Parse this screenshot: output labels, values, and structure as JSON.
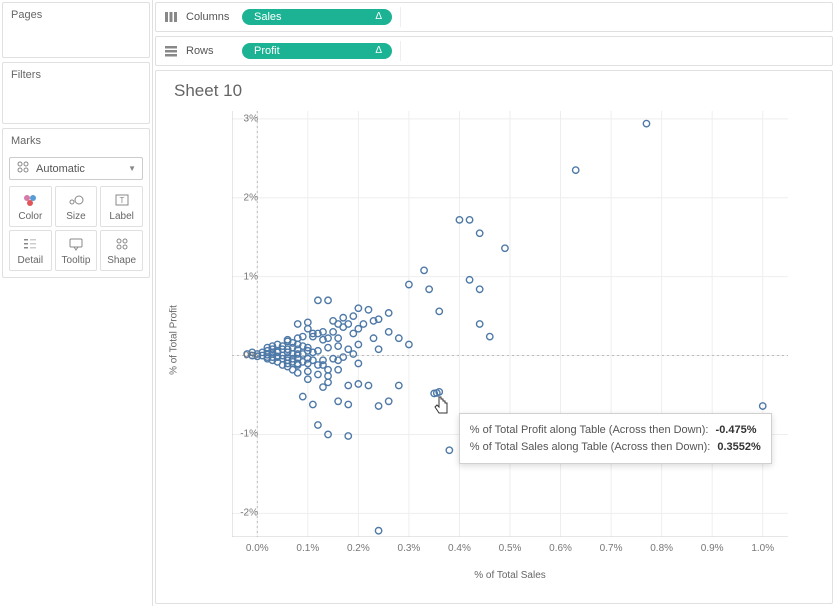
{
  "left": {
    "pages_title": "Pages",
    "filters_title": "Filters",
    "marks_title": "Marks",
    "marks_type": "Automatic",
    "cells": {
      "color": "Color",
      "size": "Size",
      "label": "Label",
      "detail": "Detail",
      "tooltip": "Tooltip",
      "shape": "Shape"
    }
  },
  "shelves": {
    "columns_label": "Columns",
    "rows_label": "Rows",
    "columns_pill": "Sales",
    "rows_pill": "Profit",
    "delta": "Δ"
  },
  "sheet": {
    "title": "Sheet 10",
    "xlabel": "% of Total Sales",
    "ylabel": "% of Total Profit"
  },
  "tooltip": {
    "line1_label": "% of Total Profit along Table (Across then Down):",
    "line1_value": "-0.475%",
    "line2_label": "% of Total Sales along Table (Across then Down):",
    "line2_value": "0.3552%"
  },
  "chart_data": {
    "type": "scatter",
    "xlabel": "% of Total Sales",
    "ylabel": "% of Total Profit",
    "xlim": [
      -0.05,
      1.05
    ],
    "ylim": [
      -2.3,
      3.1
    ],
    "xticks": [
      "0.0%",
      "0.1%",
      "0.2%",
      "0.3%",
      "0.4%",
      "0.5%",
      "0.6%",
      "0.7%",
      "0.8%",
      "0.9%",
      "1.0%"
    ],
    "yticks": [
      "-2%",
      "-1%",
      "0%",
      "1%",
      "2%",
      "3%"
    ],
    "zero_lines": true,
    "highlighted_point": {
      "x": 0.3552,
      "y": -0.475
    },
    "series": [
      {
        "name": "points",
        "points": [
          [
            0.77,
            2.94
          ],
          [
            0.63,
            2.35
          ],
          [
            0.4,
            1.72
          ],
          [
            0.42,
            1.72
          ],
          [
            0.44,
            1.55
          ],
          [
            0.49,
            1.36
          ],
          [
            0.33,
            1.08
          ],
          [
            0.42,
            0.96
          ],
          [
            0.3,
            0.9
          ],
          [
            0.34,
            0.84
          ],
          [
            0.44,
            0.84
          ],
          [
            0.12,
            0.7
          ],
          [
            0.14,
            0.7
          ],
          [
            0.2,
            0.6
          ],
          [
            0.22,
            0.58
          ],
          [
            0.26,
            0.54
          ],
          [
            0.24,
            0.46
          ],
          [
            0.36,
            0.56
          ],
          [
            0.16,
            0.4
          ],
          [
            0.18,
            0.4
          ],
          [
            0.44,
            0.4
          ],
          [
            0.1,
            0.34
          ],
          [
            0.11,
            0.28
          ],
          [
            0.12,
            0.28
          ],
          [
            0.13,
            0.3
          ],
          [
            0.14,
            0.22
          ],
          [
            0.16,
            0.22
          ],
          [
            0.2,
            0.34
          ],
          [
            0.19,
            0.28
          ],
          [
            0.23,
            0.22
          ],
          [
            0.06,
            0.18
          ],
          [
            0.07,
            0.16
          ],
          [
            0.08,
            0.14
          ],
          [
            0.09,
            0.12
          ],
          [
            0.1,
            0.1
          ],
          [
            0.05,
            0.08
          ],
          [
            0.04,
            0.06
          ],
          [
            0.06,
            0.04
          ],
          [
            0.08,
            0.02
          ],
          [
            0.46,
            0.24
          ],
          [
            0.03,
            0.02
          ],
          [
            0.03,
            0.04
          ],
          [
            0.04,
            0.04
          ],
          [
            0.02,
            0.01
          ],
          [
            0.01,
            0.0
          ],
          [
            0.0,
            -0.01
          ],
          [
            0.02,
            0.1
          ],
          [
            0.03,
            0.12
          ],
          [
            0.05,
            0.12
          ],
          [
            0.06,
            0.2
          ],
          [
            0.08,
            0.22
          ],
          [
            0.04,
            -0.02
          ],
          [
            0.05,
            -0.04
          ],
          [
            0.06,
            -0.06
          ],
          [
            0.07,
            -0.08
          ],
          [
            0.08,
            -0.1
          ],
          [
            0.1,
            -0.1
          ],
          [
            0.12,
            -0.12
          ],
          [
            0.14,
            -0.18
          ],
          [
            0.16,
            -0.18
          ],
          [
            0.1,
            -0.2
          ],
          [
            0.12,
            -0.24
          ],
          [
            0.14,
            -0.26
          ],
          [
            0.18,
            -0.38
          ],
          [
            0.2,
            -0.36
          ],
          [
            0.22,
            -0.38
          ],
          [
            0.13,
            -0.4
          ],
          [
            0.28,
            -0.38
          ],
          [
            0.09,
            -0.52
          ],
          [
            0.16,
            -0.58
          ],
          [
            0.24,
            -0.64
          ],
          [
            0.18,
            -0.62
          ],
          [
            0.26,
            -0.58
          ],
          [
            0.11,
            -0.62
          ],
          [
            0.36,
            -0.46
          ],
          [
            0.35,
            -0.48
          ],
          [
            0.12,
            -0.88
          ],
          [
            0.14,
            -1.0
          ],
          [
            0.18,
            -1.02
          ],
          [
            0.38,
            -1.2
          ],
          [
            0.24,
            -2.22
          ],
          [
            1.0,
            -0.64
          ],
          [
            0.11,
            0.24
          ],
          [
            0.13,
            0.2
          ],
          [
            0.15,
            0.3
          ],
          [
            0.17,
            0.36
          ],
          [
            0.09,
            0.24
          ],
          [
            0.07,
            0.1
          ],
          [
            0.06,
            0.08
          ],
          [
            0.08,
            0.08
          ],
          [
            0.1,
            0.06
          ],
          [
            0.12,
            0.06
          ],
          [
            0.14,
            0.1
          ],
          [
            0.16,
            0.12
          ],
          [
            0.18,
            0.08
          ],
          [
            0.2,
            0.14
          ],
          [
            0.11,
            0.04
          ],
          [
            0.09,
            0.02
          ],
          [
            0.07,
            0.02
          ],
          [
            0.05,
            0.0
          ],
          [
            0.04,
            -0.01
          ],
          [
            0.03,
            -0.02
          ],
          [
            0.02,
            -0.02
          ],
          [
            0.02,
            -0.04
          ],
          [
            0.06,
            -0.02
          ],
          [
            0.08,
            -0.04
          ],
          [
            0.1,
            -0.04
          ],
          [
            0.11,
            -0.06
          ],
          [
            0.13,
            -0.06
          ],
          [
            0.15,
            -0.04
          ],
          [
            0.17,
            -0.02
          ],
          [
            0.14,
            -0.34
          ],
          [
            0.1,
            -0.3
          ],
          [
            0.08,
            -0.22
          ],
          [
            0.07,
            -0.18
          ],
          [
            0.06,
            -0.14
          ],
          [
            -0.02,
            0.02
          ],
          [
            -0.01,
            0.04
          ],
          [
            -0.01,
            0.0
          ],
          [
            0.0,
            0.02
          ],
          [
            0.01,
            0.04
          ],
          [
            0.15,
            0.44
          ],
          [
            0.17,
            0.48
          ],
          [
            0.19,
            0.5
          ],
          [
            0.21,
            0.4
          ],
          [
            0.23,
            0.44
          ],
          [
            0.08,
            0.4
          ],
          [
            0.1,
            0.42
          ],
          [
            0.04,
            0.14
          ],
          [
            0.03,
            0.08
          ],
          [
            0.02,
            0.06
          ],
          [
            0.26,
            0.3
          ],
          [
            0.28,
            0.22
          ],
          [
            0.3,
            0.14
          ],
          [
            0.24,
            0.08
          ],
          [
            0.19,
            0.02
          ],
          [
            0.16,
            -0.06
          ],
          [
            0.2,
            -0.1
          ],
          [
            0.13,
            -0.12
          ],
          [
            0.09,
            -0.08
          ],
          [
            0.07,
            -0.04
          ],
          [
            0.05,
            -0.12
          ],
          [
            0.04,
            -0.08
          ],
          [
            0.03,
            -0.06
          ],
          [
            0.06,
            -0.1
          ],
          [
            0.08,
            -0.12
          ]
        ]
      }
    ]
  }
}
